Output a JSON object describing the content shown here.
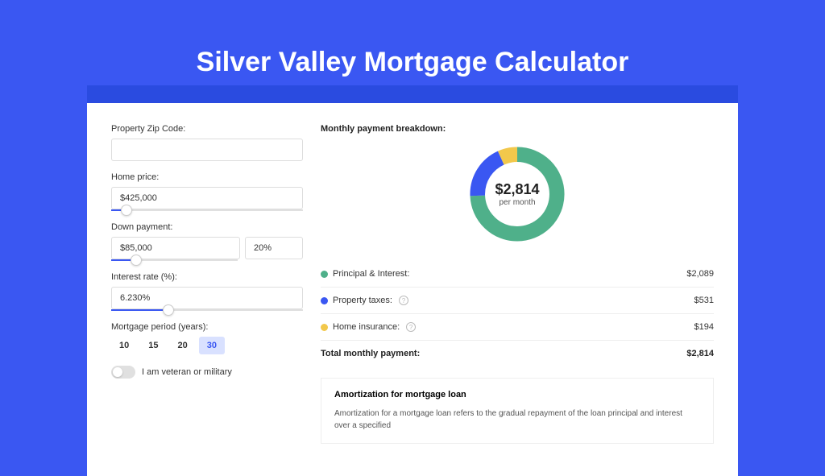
{
  "title": "Silver Valley Mortgage Calculator",
  "colors": {
    "principal": "#4fb08a",
    "taxes": "#3a57f2",
    "insurance": "#f2c84b",
    "accent": "#3a57f2"
  },
  "form": {
    "zip_label": "Property Zip Code:",
    "zip_value": "",
    "home_price_label": "Home price:",
    "home_price_value": "$425,000",
    "home_price_slider_pct": 8,
    "down_payment_label": "Down payment:",
    "down_payment_value": "$85,000",
    "down_payment_pct_value": "20%",
    "down_payment_slider_pct": 20,
    "interest_label": "Interest rate (%):",
    "interest_value": "6.230%",
    "interest_slider_pct": 30,
    "period_label": "Mortgage period (years):",
    "period_options": [
      "10",
      "15",
      "20",
      "30"
    ],
    "period_active": 3,
    "veteran_label": "I am veteran or military"
  },
  "breakdown": {
    "heading": "Monthly payment breakdown:",
    "center_amount": "$2,814",
    "center_sub": "per month",
    "rows": [
      {
        "label": "Principal & Interest:",
        "value": "$2,089",
        "colorKey": "principal",
        "info": false
      },
      {
        "label": "Property taxes:",
        "value": "$531",
        "colorKey": "taxes",
        "info": true
      },
      {
        "label": "Home insurance:",
        "value": "$194",
        "colorKey": "insurance",
        "info": true
      }
    ],
    "total_label": "Total monthly payment:",
    "total_value": "$2,814"
  },
  "chart_data": {
    "type": "pie",
    "title": "Monthly payment breakdown",
    "series": [
      {
        "name": "Principal & Interest",
        "value": 2089,
        "color": "#4fb08a"
      },
      {
        "name": "Property taxes",
        "value": 531,
        "color": "#3a57f2"
      },
      {
        "name": "Home insurance",
        "value": 194,
        "color": "#f2c84b"
      }
    ],
    "total": 2814,
    "unit": "USD/month"
  },
  "amortization": {
    "title": "Amortization for mortgage loan",
    "body": "Amortization for a mortgage loan refers to the gradual repayment of the loan principal and interest over a specified"
  }
}
